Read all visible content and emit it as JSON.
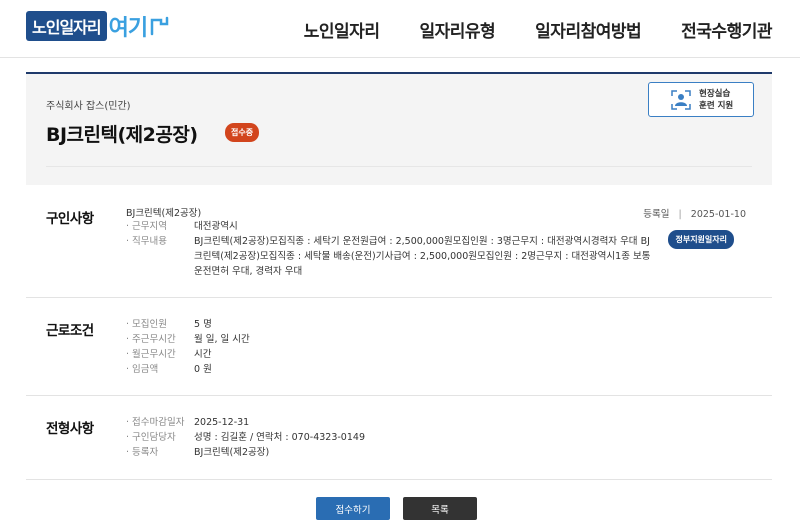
{
  "header": {
    "logo": {
      "main": "노인일자리",
      "accent": "여기"
    },
    "nav": [
      "노인일자리",
      "일자리유형",
      "일자리참여방법",
      "전국수행기관"
    ]
  },
  "company": {
    "type": "주식회사 잡스(민간)",
    "name": "BJ크린텍(제2공장)",
    "status": "접수중",
    "training": {
      "line1": "현장실습",
      "line2": "훈련 지원"
    }
  },
  "recruit": {
    "title": "구인사항",
    "company_line": "BJ크린텍(제2공장)",
    "reg_label": "등록일",
    "reg_sep": "|",
    "reg_date": "2025-01-10",
    "gov_badge": "정부지원일자리",
    "rows": [
      {
        "label": "· 근무지역",
        "value": "대전광역시"
      },
      {
        "label": "· 직무내용",
        "value": "BJ크린텍(제2공장)모집직종 : 세탁기 운전원급여 : 2,500,000원모집인원 : 3명근무지 : 대전광역시경력자 우대 BJ크린텍(제2공장)모집직종 : 세탁물 배송(운전)기사급여 : 2,500,000원모집인원 : 2명근무지 : 대전광역시1종 보통 운전면허 우대, 경력자 우대"
      }
    ]
  },
  "conditions": {
    "title": "근로조건",
    "rows": [
      {
        "label": "· 모집인원",
        "value": "5 명"
      },
      {
        "label": "· 주근무시간",
        "value": "월 일, 일 시간"
      },
      {
        "label": "· 월근무시간",
        "value": "시간"
      },
      {
        "label": "· 임금액",
        "value": "0 원"
      }
    ]
  },
  "selection": {
    "title": "전형사항",
    "rows": [
      {
        "label": "· 접수마감일자",
        "value": "2025-12-31"
      },
      {
        "label": "· 구인담당자",
        "value": "성명 : 김길훈 / 연락처 : 070-4323-0149"
      },
      {
        "label": "· 등록자",
        "value": "BJ크린텍(제2공장)"
      }
    ]
  },
  "buttons": {
    "apply": "접수하기",
    "list": "목록"
  },
  "colors": {
    "brand": "#1f4e8c",
    "status": "#d2451d",
    "apply": "#2a6db3",
    "list": "#333333"
  }
}
